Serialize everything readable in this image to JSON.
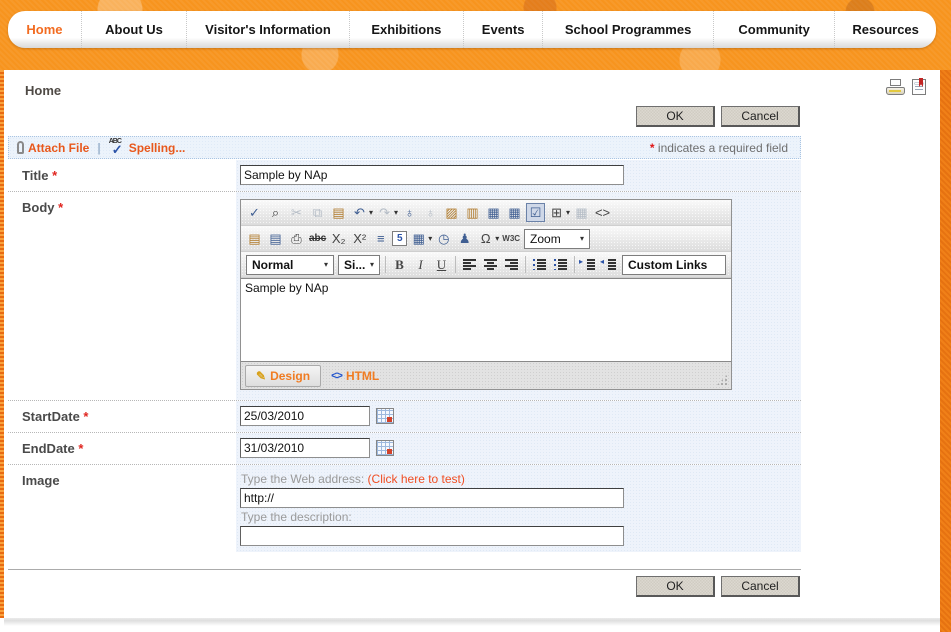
{
  "nav": {
    "items": [
      {
        "label": "Home"
      },
      {
        "label": "About Us"
      },
      {
        "label": "Visitor's Information"
      },
      {
        "label": "Exhibitions"
      },
      {
        "label": "Events"
      },
      {
        "label": "School Programmes"
      },
      {
        "label": "Community"
      },
      {
        "label": "Resources"
      }
    ]
  },
  "page": {
    "breadcrumb": "Home",
    "required_star": "*",
    "required_note": "indicates a required field"
  },
  "actions": {
    "ok": "OK",
    "cancel": "Cancel"
  },
  "attachbar": {
    "attach": "Attach File",
    "divider": "|",
    "spelling": "Spelling..."
  },
  "form": {
    "title": {
      "label": "Title",
      "star": "*",
      "value": "Sample by NAp"
    },
    "body": {
      "label": "Body",
      "star": "*"
    },
    "startdate": {
      "label": "StartDate",
      "star": "*",
      "value": "25/03/2010"
    },
    "enddate": {
      "label": "EndDate",
      "star": "*",
      "value": "31/03/2010"
    },
    "image": {
      "label": "Image",
      "web_address_label": "Type the Web address:",
      "test_link": "(Click here to test)",
      "url_value": "http://",
      "description_label": "Type the description:",
      "description_value": ""
    }
  },
  "editor": {
    "content": "Sample by NAp",
    "format_dropdown": "Normal",
    "size_dropdown": "Si...",
    "zoom_dropdown": "Zoom",
    "custom_links_dropdown": "Custom Links",
    "bold": "B",
    "italic": "I",
    "underline": "U",
    "tabs": {
      "design": "Design",
      "html": "HTML"
    },
    "tab_icons": {
      "design_pencil": "✎",
      "html_code": "<>"
    },
    "tb1": [
      {
        "g": "✓"
      },
      {
        "g": "⌕"
      },
      {
        "g": "✂"
      },
      {
        "g": "⧉"
      },
      {
        "g": "▤"
      },
      {
        "g": "↶"
      },
      {
        "g": "↷"
      },
      {
        "g": "♁"
      },
      {
        "g": "♁"
      },
      {
        "g": "▨"
      },
      {
        "g": "▥"
      },
      {
        "g": "▦"
      },
      {
        "g": "▦"
      },
      {
        "g": "☑"
      },
      {
        "g": "⊞"
      },
      {
        "g": "▦"
      },
      {
        "g": "<>"
      }
    ],
    "tb2": [
      {
        "g": "▤"
      },
      {
        "g": "▤"
      },
      {
        "g": "⎙"
      },
      {
        "g": "abc"
      },
      {
        "g": "X₂"
      },
      {
        "g": "X²"
      },
      {
        "g": "≡"
      },
      {
        "g": "5"
      },
      {
        "g": "▦"
      },
      {
        "g": "◷"
      },
      {
        "g": "♟"
      },
      {
        "g": "Ω"
      },
      {
        "g": "W3C"
      }
    ]
  },
  "ui": {
    "caret": "▾"
  },
  "colors": {
    "banner_orange": "#f7941e",
    "nav_active": "#f26c21",
    "link_orange": "#e8581c",
    "required_red": "#e0251f",
    "field_bg": "#eef3fb",
    "label_gray": "#4a4a4a"
  }
}
